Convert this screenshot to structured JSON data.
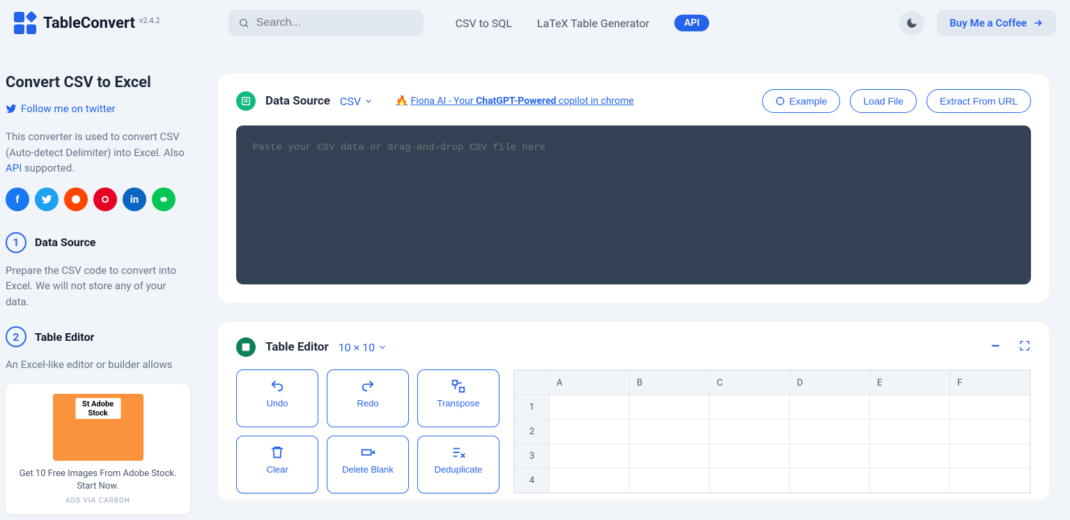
{
  "header": {
    "brand": "TableConvert",
    "version": "v2.4.2",
    "search_placeholder": "Search...",
    "nav": {
      "csv_sql": "CSV to SQL",
      "latex": "LaTeX Table Generator",
      "api": "API"
    },
    "coffee": "Buy Me a Coffee"
  },
  "sidebar": {
    "title": "Convert CSV to Excel",
    "twitter": "Follow me on twitter",
    "desc_pre": "This converter is used to convert CSV (Auto-detect Delimiter) into Excel. Also ",
    "desc_link": "API",
    "desc_post": " supported.",
    "step1": {
      "num": "1",
      "title": "Data Source",
      "desc": "Prepare the CSV code to convert into Excel. We will not store any of your data."
    },
    "step2": {
      "num": "2",
      "title": "Table Editor",
      "desc": "An Excel-like editor or builder allows"
    },
    "ad": {
      "stock": "St",
      "brand": "Adobe Stock",
      "text": "Get 10 Free Images From Adobe Stock. Start Now.",
      "via": "ADS VIA CARBON"
    }
  },
  "source_card": {
    "title": "Data Source",
    "select": "CSV",
    "promo_fire": "🔥",
    "promo_text_pre": "Fiona AI - Your ",
    "promo_text_bold": "ChatGPT-Powered",
    "promo_text_post": " copilot in chrome",
    "example": "Example",
    "load_file": "Load File",
    "extract_url": "Extract From URL",
    "placeholder": "Paste your CSV data or drag-and-drop CSV file here"
  },
  "editor_card": {
    "title": "Table Editor",
    "size": "10 × 10",
    "tools": {
      "undo": "Undo",
      "redo": "Redo",
      "transpose": "Transpose",
      "clear": "Clear",
      "delete_blank": "Delete Blank",
      "dedup": "Deduplicate"
    },
    "columns": [
      "A",
      "B",
      "C",
      "D",
      "E",
      "F"
    ],
    "rows": [
      "1",
      "2",
      "3",
      "4"
    ]
  }
}
